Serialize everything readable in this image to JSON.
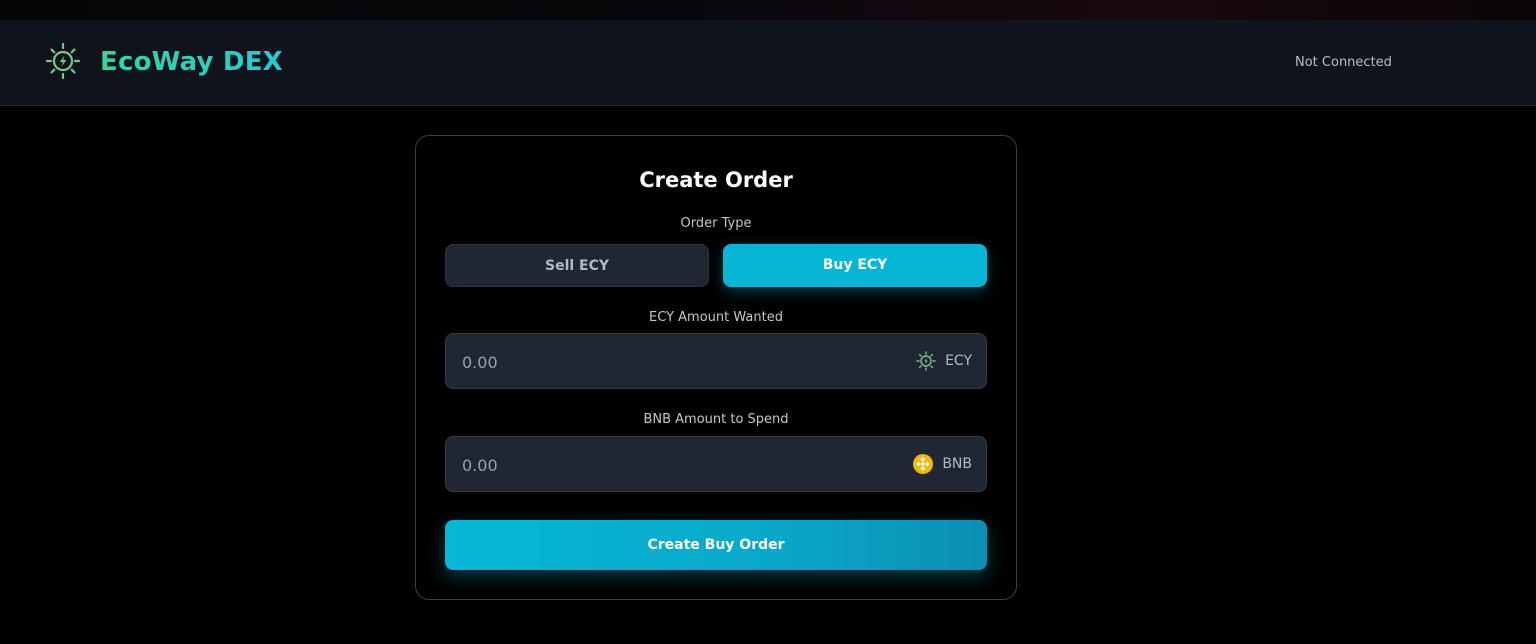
{
  "header": {
    "brand": "EcoWay DEX",
    "logo_icon": "solar-bolt-logo-icon",
    "connection_status": "Not Connected"
  },
  "order_card": {
    "title": "Create Order",
    "order_type_label": "Order Type",
    "order_types": [
      {
        "label": "Sell ECY",
        "selected": false
      },
      {
        "label": "Buy ECY",
        "selected": true
      }
    ],
    "ecy_field": {
      "label": "ECY Amount Wanted",
      "placeholder": "0.00",
      "token": "ECY",
      "token_icon": "ecy-token-icon"
    },
    "bnb_field": {
      "label": "BNB Amount to Spend",
      "placeholder": "0.00",
      "token": "BNB",
      "token_icon": "bnb-token-icon"
    },
    "submit_label": "Create Buy Order"
  },
  "colors": {
    "accent": "#06b6d4",
    "brand_green": "#3ad49a",
    "brand_teal": "#27c9d6",
    "field_bg": "#1f2733",
    "bnb_gold": "#f0b90b"
  }
}
